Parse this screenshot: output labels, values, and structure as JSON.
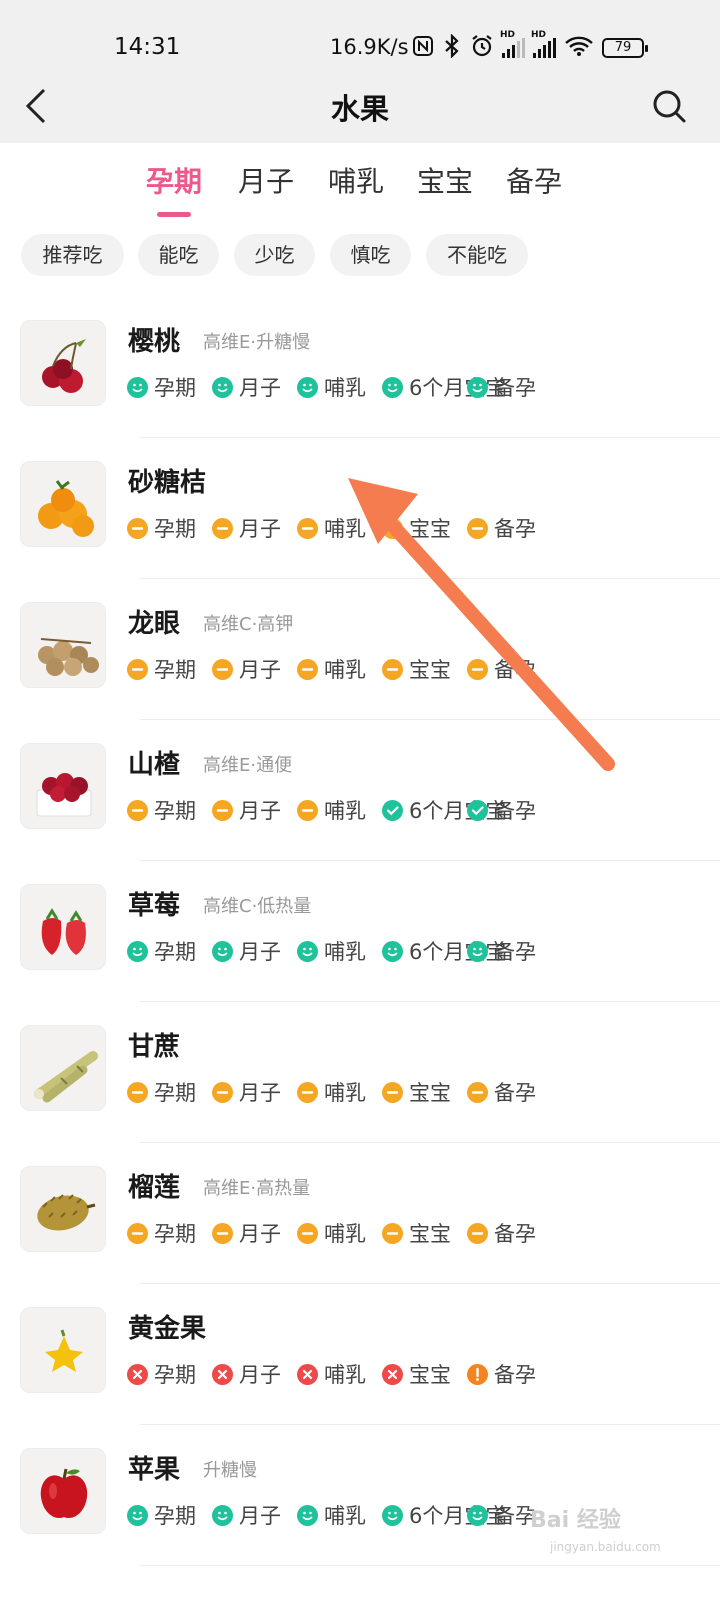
{
  "status_bar": {
    "time": "14:31",
    "net_speed": "16.9K/s",
    "battery": "79",
    "icons": [
      "nfc-icon",
      "bluetooth-icon",
      "alarm-icon",
      "signal-hd-icon",
      "signal-hd-icon",
      "wifi-icon",
      "battery-icon"
    ]
  },
  "header": {
    "title": "水果"
  },
  "tabs": [
    {
      "label": "孕期",
      "active": true
    },
    {
      "label": "月子"
    },
    {
      "label": "哺乳"
    },
    {
      "label": "宝宝"
    },
    {
      "label": "备孕"
    }
  ],
  "filters": [
    "推荐吃",
    "能吃",
    "少吃",
    "慎吃",
    "不能吃"
  ],
  "status_colors": {
    "ok": "#1fc29a",
    "limit": "#f5a623",
    "no": "#ef4a4a",
    "caution": "#f5831f"
  },
  "foods": [
    {
      "name": "樱桃",
      "tagline": "高维E·升糖慢",
      "statuses": [
        {
          "label": "孕期",
          "level": "ok"
        },
        {
          "label": "月子",
          "level": "ok"
        },
        {
          "label": "哺乳",
          "level": "ok"
        },
        {
          "label": "6个月宝宝",
          "level": "ok"
        },
        {
          "label": "备孕",
          "level": "ok"
        }
      ]
    },
    {
      "name": "砂糖桔",
      "tagline": "",
      "statuses": [
        {
          "label": "孕期",
          "level": "limit"
        },
        {
          "label": "月子",
          "level": "limit"
        },
        {
          "label": "哺乳",
          "level": "limit"
        },
        {
          "label": "宝宝",
          "level": "limit"
        },
        {
          "label": "备孕",
          "level": "limit"
        }
      ]
    },
    {
      "name": "龙眼",
      "tagline": "高维C·高钾",
      "statuses": [
        {
          "label": "孕期",
          "level": "limit"
        },
        {
          "label": "月子",
          "level": "limit"
        },
        {
          "label": "哺乳",
          "level": "limit"
        },
        {
          "label": "宝宝",
          "level": "limit"
        },
        {
          "label": "备孕",
          "level": "limit"
        }
      ]
    },
    {
      "name": "山楂",
      "tagline": "高维E·通便",
      "statuses": [
        {
          "label": "孕期",
          "level": "limit"
        },
        {
          "label": "月子",
          "level": "limit"
        },
        {
          "label": "哺乳",
          "level": "limit"
        },
        {
          "label": "6个月宝宝",
          "level": "check"
        },
        {
          "label": "备孕",
          "level": "check"
        }
      ]
    },
    {
      "name": "草莓",
      "tagline": "高维C·低热量",
      "statuses": [
        {
          "label": "孕期",
          "level": "ok"
        },
        {
          "label": "月子",
          "level": "ok"
        },
        {
          "label": "哺乳",
          "level": "ok"
        },
        {
          "label": "6个月宝宝",
          "level": "ok"
        },
        {
          "label": "备孕",
          "level": "ok"
        }
      ]
    },
    {
      "name": "甘蔗",
      "tagline": "",
      "statuses": [
        {
          "label": "孕期",
          "level": "limit"
        },
        {
          "label": "月子",
          "level": "limit"
        },
        {
          "label": "哺乳",
          "level": "limit"
        },
        {
          "label": "宝宝",
          "level": "limit"
        },
        {
          "label": "备孕",
          "level": "limit"
        }
      ]
    },
    {
      "name": "榴莲",
      "tagline": "高维E·高热量",
      "statuses": [
        {
          "label": "孕期",
          "level": "limit"
        },
        {
          "label": "月子",
          "level": "limit"
        },
        {
          "label": "哺乳",
          "level": "limit"
        },
        {
          "label": "宝宝",
          "level": "limit"
        },
        {
          "label": "备孕",
          "level": "limit"
        }
      ]
    },
    {
      "name": "黄金果",
      "tagline": "",
      "statuses": [
        {
          "label": "孕期",
          "level": "no"
        },
        {
          "label": "月子",
          "level": "no"
        },
        {
          "label": "哺乳",
          "level": "no"
        },
        {
          "label": "宝宝",
          "level": "no"
        },
        {
          "label": "备孕",
          "level": "caution"
        }
      ]
    },
    {
      "name": "苹果",
      "tagline": "升糖慢",
      "statuses": [
        {
          "label": "孕期",
          "level": "ok"
        },
        {
          "label": "月子",
          "level": "ok"
        },
        {
          "label": "哺乳",
          "level": "ok"
        },
        {
          "label": "6个月宝宝",
          "level": "ok"
        },
        {
          "label": "备孕",
          "level": "ok"
        }
      ]
    }
  ],
  "watermark": {
    "text": "Bai 经验",
    "sub": "jingyan.baidu.com"
  }
}
